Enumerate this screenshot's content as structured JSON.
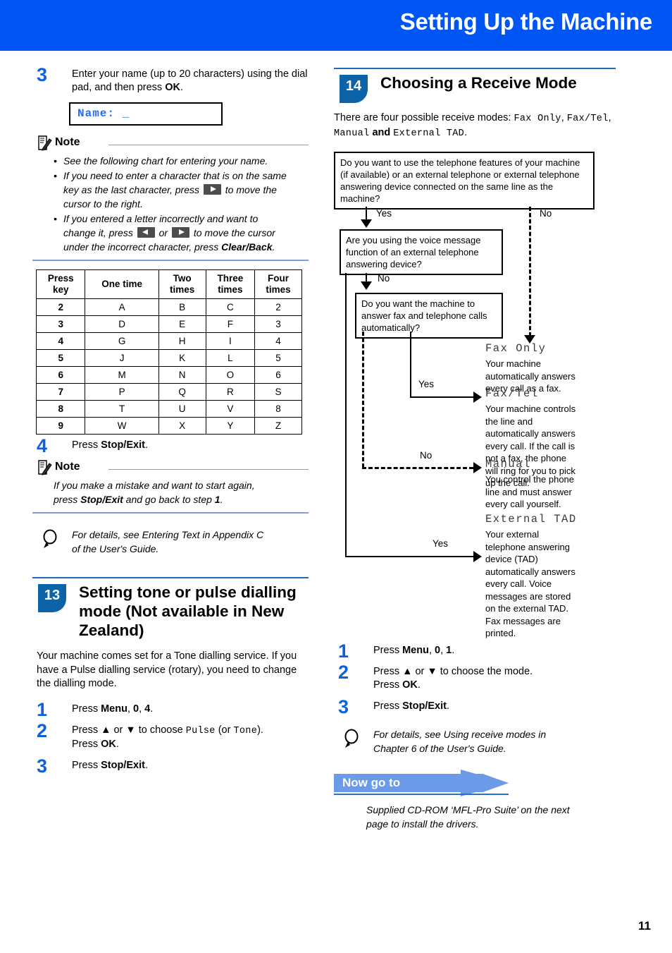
{
  "header": {
    "title": "Setting Up the Machine"
  },
  "page_number": "11",
  "left": {
    "step3": {
      "num": "3",
      "text_1": "Enter your name (up to 20 characters) using the dial pad, and then press ",
      "bold_ok": "OK",
      "text_2": "."
    },
    "lcd_display": "Name: _",
    "note1": {
      "title": "Note",
      "bullets": [
        "See the following chart for entering your name.",
        "If you need to enter a character that is on the same key as the last character, press ▶ to move the cursor to the right.",
        "If you entered a letter incorrectly and want to change it, press ◀ or ▶ to move the cursor under the incorrect character, press Clear/Back."
      ],
      "b2_part1": "If you need to enter a character that is on the same",
      "b2_part2": "key as the last character, press",
      "b2_part3": "to move the",
      "b2_part4": "cursor to the right.",
      "b3_part1": "If you entered a letter incorrectly and want to",
      "b3_part2": "change it, press",
      "b3_or": "or",
      "b3_part3": "to move the cursor",
      "b3_part4": "under the incorrect character, press ",
      "b3_bold": "Clear/Back",
      "b3_end": "."
    },
    "char_table": {
      "headers": [
        "Press key",
        "One time",
        "Two times",
        "Three times",
        "Four times"
      ],
      "rows": [
        [
          "2",
          "A",
          "B",
          "C",
          "2"
        ],
        [
          "3",
          "D",
          "E",
          "F",
          "3"
        ],
        [
          "4",
          "G",
          "H",
          "I",
          "4"
        ],
        [
          "5",
          "J",
          "K",
          "L",
          "5"
        ],
        [
          "6",
          "M",
          "N",
          "O",
          "6"
        ],
        [
          "7",
          "P",
          "Q",
          "R",
          "S"
        ],
        [
          "8",
          "T",
          "U",
          "V",
          "8"
        ],
        [
          "9",
          "W",
          "X",
          "Y",
          "Z"
        ]
      ]
    },
    "step4": {
      "num": "4",
      "text_pre": "Press ",
      "bold": "Stop/Exit",
      "text_post": "."
    },
    "note2": {
      "title": "Note",
      "line1": "If you make a mistake and want to start again,",
      "line2_pre": "press ",
      "line2_bold": "Stop/Exit",
      "line2_mid": " and go back to step ",
      "line2_bold2": "1",
      "line2_end": "."
    },
    "tip1": {
      "line1": "For details, see Entering Text in Appendix C",
      "line2": "of the User's Guide."
    },
    "section13": {
      "badge": "13",
      "title": "Setting tone or pulse dialling mode (Not available in New Zealand)",
      "para": "Your machine comes set for a Tone dialling service. If you have a Pulse dialling service (rotary), you need to change the dialling mode.",
      "steps": [
        {
          "num": "1",
          "pre": "Press ",
          "b1": "Menu",
          "mid1": ", ",
          "b2": "0",
          "mid2": ", ",
          "b3": "4",
          "end": "."
        },
        {
          "num": "2",
          "pre": "Press ▲ or ▼ to choose ",
          "mono1": "Pulse",
          "mid": " (or ",
          "mono2": "Tone",
          "end": ").",
          "line2_pre": "Press ",
          "line2_bold": "OK",
          "line2_end": "."
        },
        {
          "num": "3",
          "pre": "Press ",
          "b1": "Stop/Exit",
          "end": "."
        }
      ]
    }
  },
  "right": {
    "section14": {
      "badge": "14",
      "title": "Choosing a Receive Mode",
      "intro_pre": "There are four possible receive modes: ",
      "intro_mode1": "Fax Only",
      "intro_sep1": ", ",
      "intro_mode2": "Fax/Tel",
      "intro_sep2": ", ",
      "intro_mode3": "Manual",
      "intro_and": " and ",
      "intro_mode4": "External TAD",
      "intro_end": "."
    },
    "flowchart": {
      "box1": "Do you want to use the telephone features of your machine (if available) or an external telephone or external telephone answering device connected on the same line as the machine?",
      "box2": "Are you using the voice message function of an external telephone answering device?",
      "box3": "Do you want the machine to answer fax and telephone calls automatically?",
      "label_yes1": "Yes",
      "label_no1": "No",
      "label_no2": "No",
      "label_yes_faxtel": "Yes",
      "label_no_manual": "No",
      "label_yes_tad": "Yes",
      "modes": [
        {
          "name": "Fax Only",
          "desc": "Your machine automatically answers every call as a fax."
        },
        {
          "name": "Fax/Tel",
          "desc": "Your machine controls the line and automatically answers every call. If the call is not a fax, the phone will ring for you to pick up the call."
        },
        {
          "name": "Manual",
          "desc": "You control the phone line and must answer every call yourself."
        },
        {
          "name": "External TAD",
          "desc": "Your external telephone answering device (TAD) automatically answers every call. Voice messages are stored on the external TAD. Fax messages are printed."
        }
      ]
    },
    "steps": [
      {
        "num": "1",
        "pre": "Press ",
        "b1": "Menu",
        "mid1": ", ",
        "b2": "0",
        "mid2": ", ",
        "b3": "1",
        "end": "."
      },
      {
        "num": "2",
        "pre": "Press ▲ or ▼ to choose the mode.",
        "line2_pre": "Press ",
        "line2_bold": "OK",
        "line2_end": "."
      },
      {
        "num": "3",
        "pre": "Press ",
        "b1": "Stop/Exit",
        "end": "."
      }
    ],
    "tip2": {
      "line1": "For details, see Using receive modes in",
      "line2": "Chapter 6 of the User's Guide."
    },
    "nowgo": {
      "label": "Now go to",
      "line1": "Supplied CD-ROM ‘MFL-Pro Suite’ on the next",
      "line2": "page to install the drivers."
    }
  }
}
